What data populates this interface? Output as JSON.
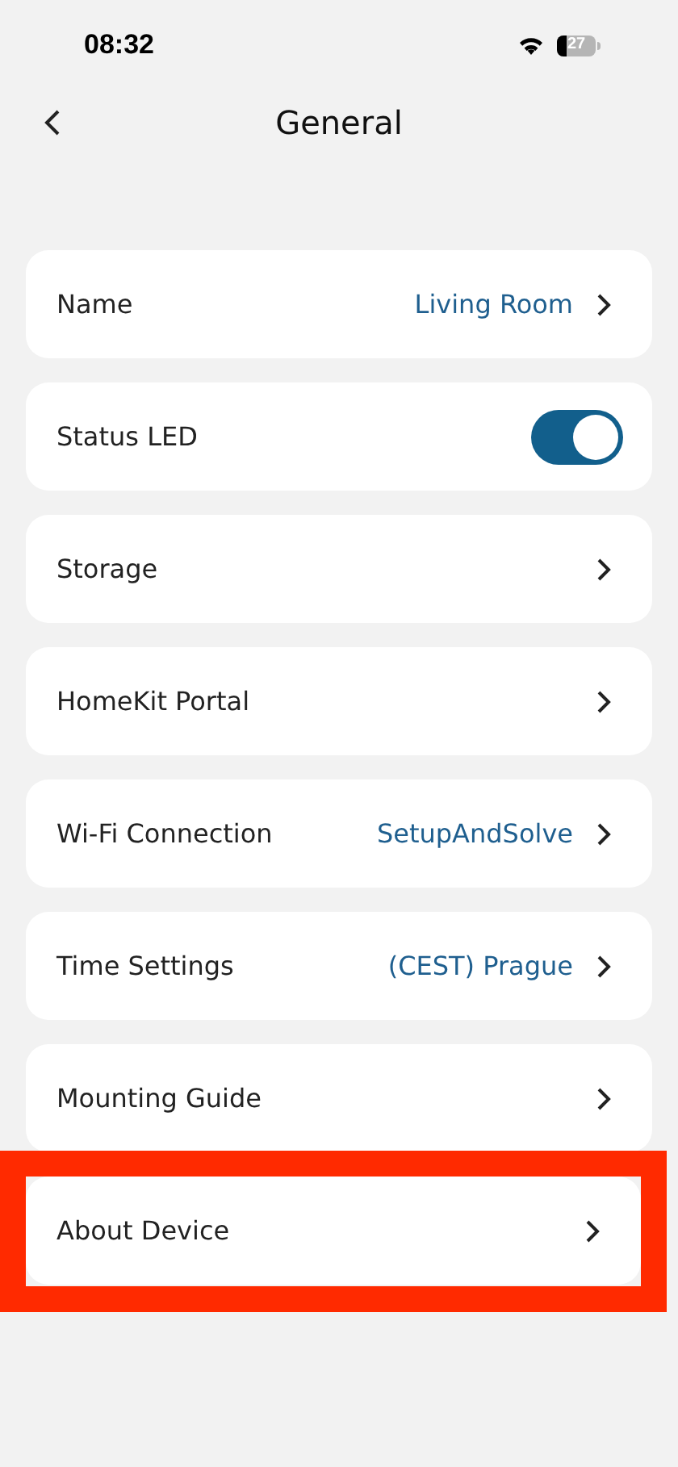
{
  "status_bar": {
    "time": "08:32",
    "battery": "27"
  },
  "header": {
    "title": "General"
  },
  "items": [
    {
      "kind": "link",
      "label": "Name",
      "value": "Living Room",
      "highlighted": false
    },
    {
      "kind": "toggle",
      "label": "Status LED",
      "on": true,
      "highlighted": false
    },
    {
      "kind": "link",
      "label": "Storage",
      "highlighted": false
    },
    {
      "kind": "link",
      "label": "HomeKit Portal",
      "highlighted": false
    },
    {
      "kind": "link",
      "label": "Wi-Fi Connection",
      "value": "SetupAndSolve",
      "highlighted": false
    },
    {
      "kind": "link",
      "label": "Time Settings",
      "value": "(CEST) Prague",
      "highlighted": false
    },
    {
      "kind": "link",
      "label": "Mounting Guide",
      "highlighted": false
    },
    {
      "kind": "link",
      "label": "About Device",
      "highlighted": true
    }
  ]
}
